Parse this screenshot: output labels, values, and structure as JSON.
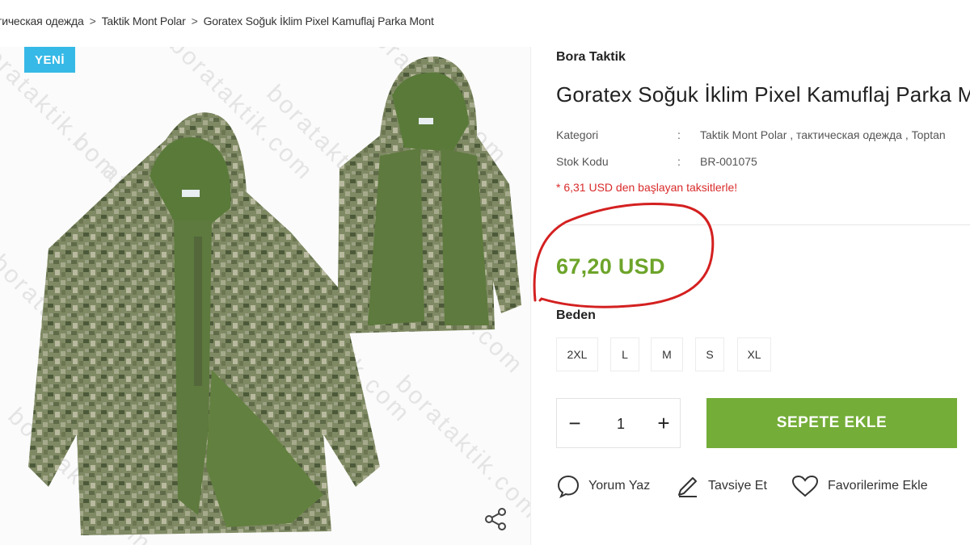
{
  "breadcrumb": {
    "items": [
      "тическая одежда",
      "Taktik Mont Polar",
      "Goratex Soğuk İklim Pixel Kamuflaj Parka Mont"
    ],
    "separator": ">"
  },
  "gallery": {
    "badge": "YENİ",
    "watermark": "borataktik.com",
    "share_icon": "share-icon"
  },
  "product": {
    "brand": "Bora Taktik",
    "title": "Goratex Soğuk İklim Pixel Kamuflaj Parka Mont",
    "category_label": "Kategori",
    "category_value": "Taktik Mont Polar , тактическая одежда , Toptan",
    "sku_label": "Stok Kodu",
    "sku_value": "BR-001075",
    "colon": ":",
    "installment": "* 6,31 USD den başlayan taksitlerle!",
    "price": "67,20 USD"
  },
  "size": {
    "label": "Beden",
    "options": [
      "2XL",
      "L",
      "M",
      "S",
      "XL"
    ]
  },
  "cart": {
    "quantity": "1",
    "minus": "−",
    "plus": "+",
    "add_label": "SEPETE EKLE"
  },
  "actions": {
    "review": "Yorum Yaz",
    "recommend": "Tavsiye Et",
    "favorite": "Favorilerime Ekle"
  },
  "colors": {
    "price": "#6da42a",
    "add_button": "#74ad38",
    "badge": "#36b9e6",
    "installment": "#d92b2b",
    "annotation": "#d42020"
  }
}
